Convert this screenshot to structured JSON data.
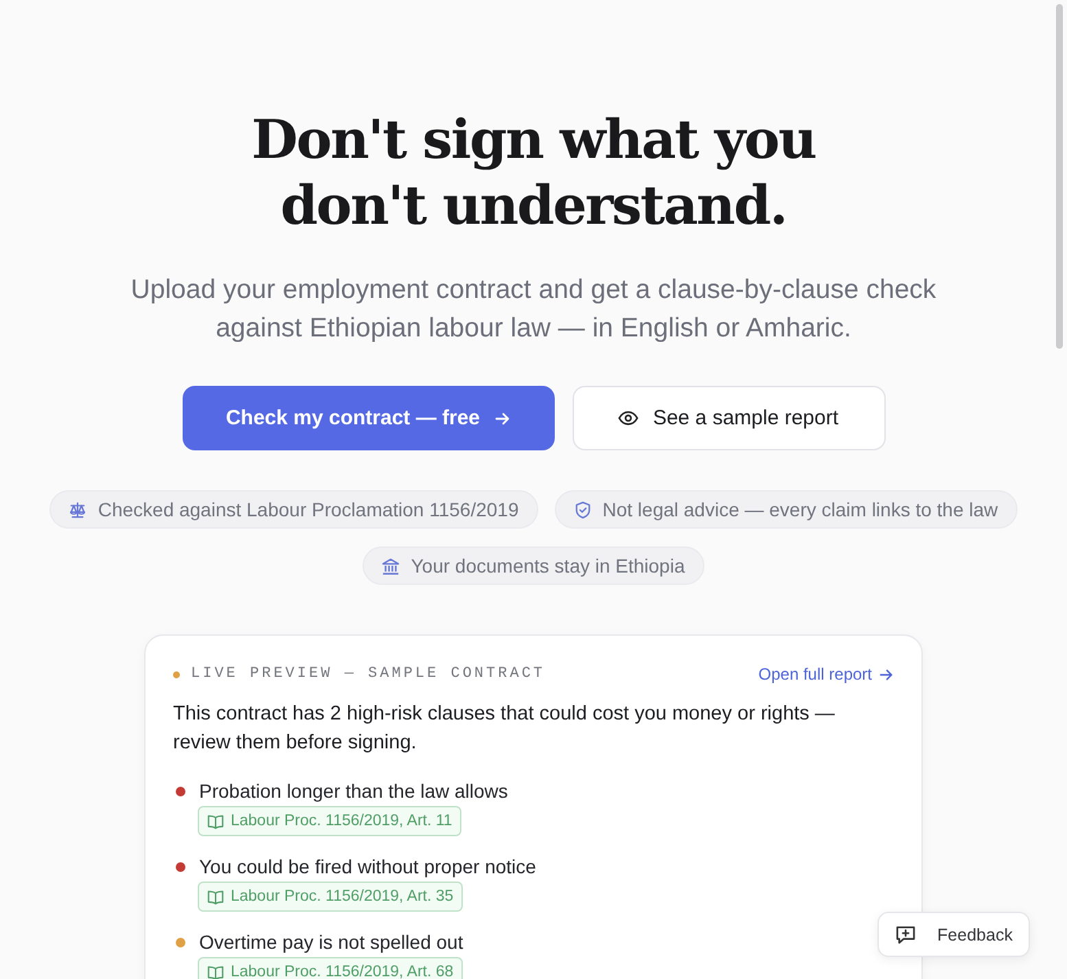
{
  "hero": {
    "title": "Don't sign what you don't understand.",
    "subtitle": "Upload your employment contract and get a clause-by-clause check against Ethiopian labour law — in English or Amharic.",
    "buttons": [
      {
        "kind": "primary",
        "label": "Check my contract — free"
      },
      {
        "kind": "secondary",
        "label": "See a sample report"
      }
    ]
  },
  "badges": [
    "Checked against Labour Proclamation 1156/2019",
    "Not legal advice — every claim links to the law",
    "Your documents stay in Ethiopia"
  ],
  "preview": {
    "label": "LIVE PREVIEW — SAMPLE CONTRACT",
    "link": "Open full report",
    "summary": "This contract has 2 high-risk clauses that could cost you money or rights — review them before signing.",
    "findings": [
      {
        "title": "Probation longer than the law allows",
        "color": "#c43b35",
        "citation": "Labour Proc. 1156/2019, Art. 11"
      },
      {
        "title": "You could be fired without proper notice",
        "color": "#c43b35",
        "citation": "Labour Proc. 1156/2019, Art. 35"
      },
      {
        "title": "Overtime pay is not spelled out",
        "color": "#e0a046",
        "citation": "Labour Proc. 1156/2019, Art. 68"
      }
    ]
  },
  "feedback": {
    "label": "Feedback"
  }
}
